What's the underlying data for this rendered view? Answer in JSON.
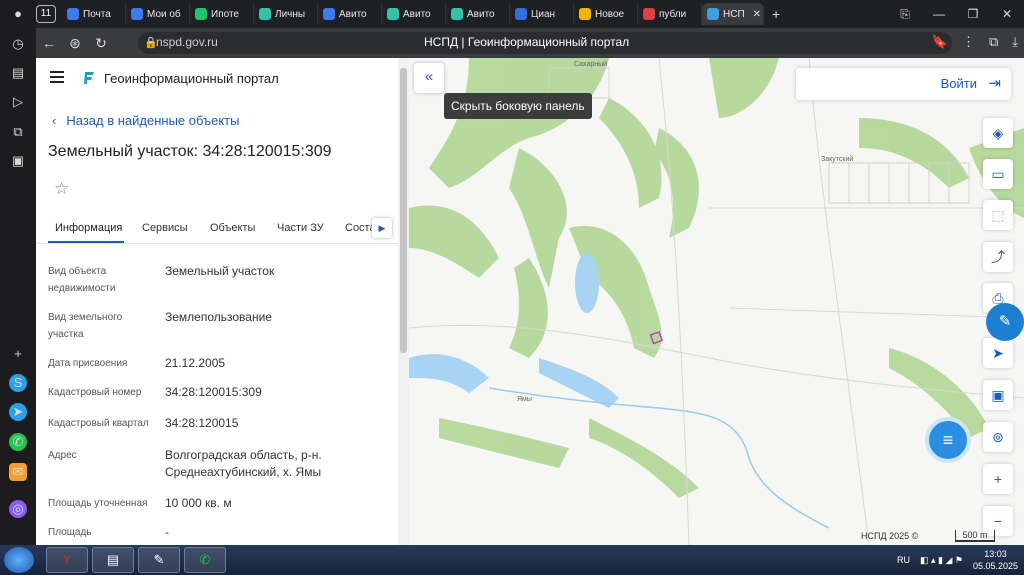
{
  "browser": {
    "tab_count": "11",
    "tabs": [
      {
        "label": "Почта",
        "color": "#3d7bf0"
      },
      {
        "label": "Мои об",
        "color": "#3d7bf0"
      },
      {
        "label": "Ипоте",
        "color": "#23c26b"
      },
      {
        "label": "Личны",
        "color": "#36c0a5"
      },
      {
        "label": "Авито",
        "color": "#3d7bf0"
      },
      {
        "label": "Авито",
        "color": "#36c0a5"
      },
      {
        "label": "Авито",
        "color": "#36c0a5"
      },
      {
        "label": "Циан",
        "color": "#2f6fe0"
      },
      {
        "label": "Новое",
        "color": "#f0b400"
      },
      {
        "label": "публи",
        "color": "#e04040"
      },
      {
        "label": "НСП",
        "color": "#3aa0e0"
      }
    ],
    "url": "nspd.gov.ru",
    "title": "НСПД | Геоинформационный портал"
  },
  "side": {
    "portal_name": "Геоинформационный портал",
    "back_label": "Назад в найденные объекты",
    "heading": "Земельный участок: 34:28:120015:309",
    "tabs": [
      "Информация",
      "Сервисы",
      "Объекты",
      "Части ЗУ",
      "Соста"
    ],
    "rows": [
      {
        "label": "Вид объекта недвижимости",
        "value": "Земельный участок"
      },
      {
        "label": "Вид земельного участка",
        "value": "Землепользование"
      },
      {
        "label": "Дата присвоения",
        "value": "21.12.2005"
      },
      {
        "label": "Кадастровый номер",
        "value": "34:28:120015:309"
      },
      {
        "label": "Кадастровый квартал",
        "value": "34:28:120015"
      },
      {
        "label": "Адрес",
        "value": "Волгоградская область, р-н. Среднеахтубинский, х. Ямы"
      },
      {
        "label": "Площадь уточненная",
        "value": "10 000 кв. м"
      },
      {
        "label": "Площадь",
        "value": "-"
      }
    ]
  },
  "map": {
    "tooltip": "Скрыть боковую панель",
    "login": "Войти",
    "copyright": "НСПД 2025 ©",
    "scale": "500 m",
    "labels": [
      "Сахарный",
      "Закутский",
      "Ямы"
    ]
  },
  "taskbar": {
    "lang": "RU",
    "time": "13:03",
    "date": "05.05.2025"
  }
}
